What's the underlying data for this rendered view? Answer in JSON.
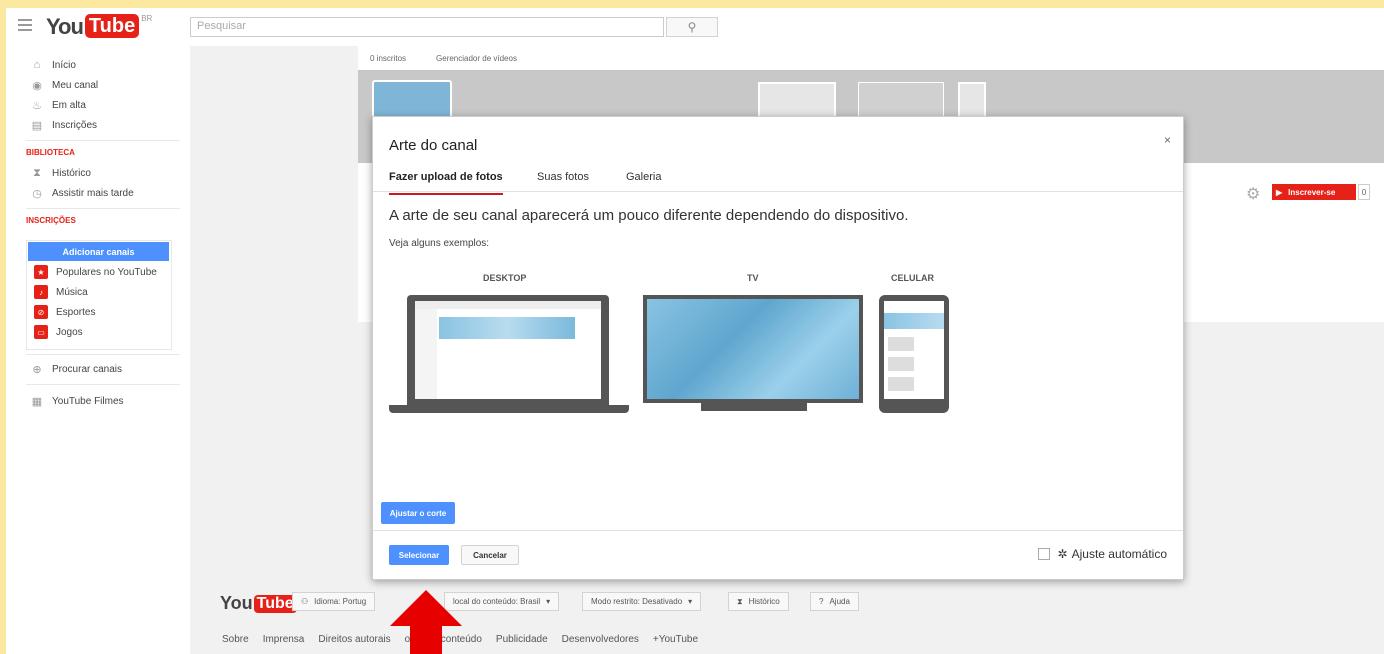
{
  "header": {
    "logo_you": "You",
    "logo_tube": "Tube",
    "logo_region": "BR",
    "search_placeholder": "Pesquisar"
  },
  "sidebar": {
    "nav": [
      {
        "label": "Início",
        "icon": "home-icon"
      },
      {
        "label": "Meu canal",
        "icon": "user-icon"
      },
      {
        "label": "Em alta",
        "icon": "flame-icon"
      },
      {
        "label": "Inscrições",
        "icon": "subscriptions-icon"
      }
    ],
    "library_title": "BIBLIOTECA",
    "library": [
      {
        "label": "Histórico",
        "icon": "hourglass-icon"
      },
      {
        "label": "Assistir mais tarde",
        "icon": "clock-icon"
      }
    ],
    "subscriptions_title": "INSCRIÇÕES",
    "add_channels": "Adicionar canais",
    "subscriptions": [
      {
        "label": "Populares no YouTube",
        "icon": "star-icon"
      },
      {
        "label": "Música",
        "icon": "music-icon"
      },
      {
        "label": "Esportes",
        "icon": "sports-icon"
      },
      {
        "label": "Jogos",
        "icon": "gamepad-icon"
      }
    ],
    "browse_channels": "Procurar canais",
    "movies": "YouTube Filmes"
  },
  "channel": {
    "subscribers": "0 inscritos",
    "video_manager": "Gerenciador de vídeos",
    "subscribe_label": "Inscrever-se",
    "subscribe_count": "0"
  },
  "modal": {
    "title": "Arte do canal",
    "close": "×",
    "tabs": [
      "Fazer upload de fotos",
      "Suas fotos",
      "Galeria"
    ],
    "heading": "A arte de seu canal aparecerá um pouco diferente dependendo do dispositivo.",
    "subheading": "Veja alguns exemplos:",
    "devices": [
      "DESKTOP",
      "TV",
      "CELULAR"
    ],
    "adjust_crop": "Ajustar o corte",
    "select": "Selecionar",
    "cancel": "Cancelar",
    "auto_adjust": "Ajuste automático"
  },
  "footer": {
    "language_btn": "Idioma: Portug",
    "location_btn": "local do conteúdo: Brasil",
    "restricted_btn": "Modo restrito: Desativado",
    "history_btn": "Histórico",
    "help_btn": "Ajuda",
    "links": [
      "Sobre",
      "Imprensa",
      "Direitos autorais",
      "ores de conteúdo",
      "Publicidade",
      "Desenvolvedores",
      "+YouTube"
    ]
  }
}
